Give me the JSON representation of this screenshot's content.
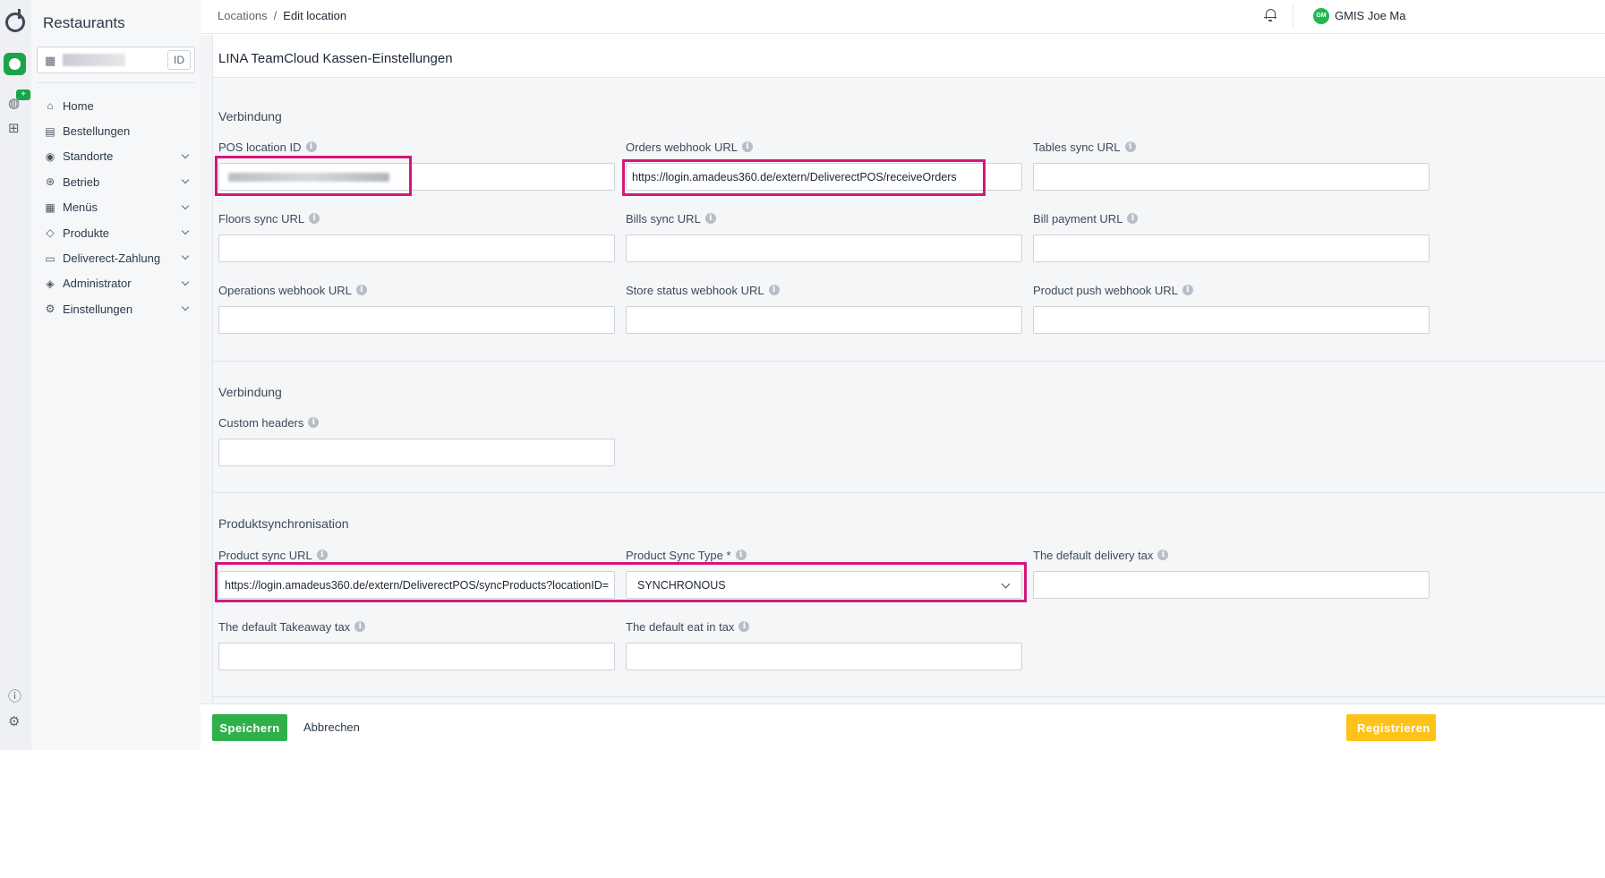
{
  "rail": {
    "logo_icon": "deliverect-logo-icon",
    "app_icon": "app-badge-icon",
    "icons": [
      "integrations-icon",
      "apps-grid-icon",
      "help-icon",
      "settings-gear-icon"
    ],
    "new_badge": "+"
  },
  "sidebar": {
    "title": "Restaurants",
    "store_id_button": "ID",
    "items": [
      {
        "label": "Home",
        "icon": "home-icon",
        "glyph": "⌂",
        "chevron": false
      },
      {
        "label": "Bestellungen",
        "icon": "receipt-icon",
        "glyph": "▤",
        "chevron": false
      },
      {
        "label": "Standorte",
        "icon": "location-pin-icon",
        "glyph": "◉",
        "chevron": true
      },
      {
        "label": "Betrieb",
        "icon": "operations-icon",
        "glyph": "⊛",
        "chevron": true
      },
      {
        "label": "Menüs",
        "icon": "menu-book-icon",
        "glyph": "▦",
        "chevron": true
      },
      {
        "label": "Produkte",
        "icon": "tag-icon",
        "glyph": "◇",
        "chevron": true
      },
      {
        "label": "Deliverect-Zahlung",
        "icon": "wallet-icon",
        "glyph": "▭",
        "chevron": true
      },
      {
        "label": "Administrator",
        "icon": "admin-shield-icon",
        "glyph": "◈",
        "chevron": true
      },
      {
        "label": "Einstellungen",
        "icon": "settings-icon",
        "glyph": "⚙",
        "chevron": true
      }
    ]
  },
  "header": {
    "breadcrumb_parent": "Locations",
    "breadcrumb_separator": "/",
    "breadcrumb_current": "Edit location",
    "avatar_initials": "GM",
    "user_name": "GMIS Joe Ma"
  },
  "main": {
    "panel_title": "LINA TeamCloud Kassen-Einstellungen",
    "sections": {
      "connection1_title": "Verbindung",
      "connection2_title": "Verbindung",
      "product_sync_title": "Produktsynchronisation"
    },
    "fields": {
      "pos_location_id": {
        "label": "POS location ID",
        "value": ""
      },
      "orders_webhook_url": {
        "label": "Orders webhook URL",
        "value": "https://login.amadeus360.de/extern/DeliverectPOS/receiveOrders"
      },
      "tables_sync_url": {
        "label": "Tables sync URL",
        "value": ""
      },
      "floors_sync_url": {
        "label": "Floors sync URL",
        "value": ""
      },
      "bills_sync_url": {
        "label": "Bills sync URL",
        "value": ""
      },
      "bill_payment_url": {
        "label": "Bill payment URL",
        "value": ""
      },
      "operations_webhook_url": {
        "label": "Operations webhook URL",
        "value": ""
      },
      "store_status_webhook_url": {
        "label": "Store status webhook URL",
        "value": ""
      },
      "product_push_webhook_url": {
        "label": "Product push webhook URL",
        "value": ""
      },
      "custom_headers": {
        "label": "Custom headers",
        "value": ""
      },
      "product_sync_url": {
        "label": "Product sync URL",
        "value": "https://login.amadeus360.de/extern/DeliverectPOS/syncProducts?locationID="
      },
      "product_sync_type": {
        "label": "Product Sync Type *",
        "value": "SYNCHRONOUS"
      },
      "default_delivery_tax": {
        "label": "The default delivery tax",
        "value": ""
      },
      "default_takeaway_tax": {
        "label": "The default Takeaway tax",
        "value": ""
      },
      "default_eat_in_tax": {
        "label": "The default eat in tax",
        "value": ""
      }
    },
    "info_glyph": "i",
    "highlight_color": "#d4177c"
  },
  "footer": {
    "save_label": "Speichern",
    "cancel_label": "Abbrechen",
    "register_label": "Registrieren"
  },
  "colors": {
    "primary_green": "#2fb04b",
    "accent_yellow": "#ffc21a",
    "highlight_magenta": "#d4177c"
  }
}
